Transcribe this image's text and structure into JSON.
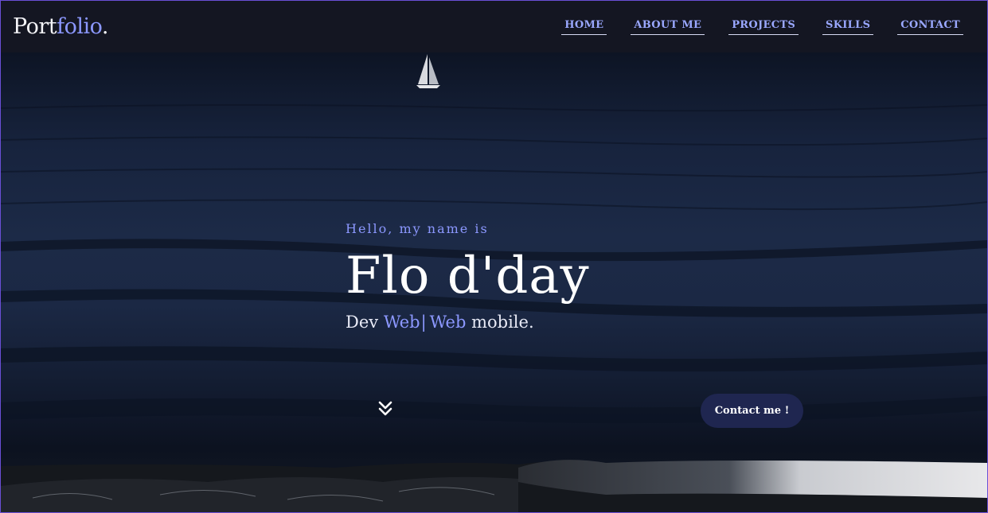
{
  "header": {
    "logo_main": "Port",
    "logo_accent": "folio",
    "logo_dot": ".",
    "nav": [
      {
        "label": "HOME"
      },
      {
        "label": "ABOUT ME"
      },
      {
        "label": "PROJECTS"
      },
      {
        "label": "SKILLS"
      },
      {
        "label": "CONTACT"
      }
    ]
  },
  "hero": {
    "intro": "Hello, my name is",
    "name": "Flo d'day",
    "role_prefix": "Dev",
    "role_word1": "Web",
    "role_separator": "|",
    "role_word2": "Web",
    "role_suffix": "mobile.",
    "scroll_icon": "double-chevron-down-icon",
    "contact_button": "Contact me !"
  },
  "colors": {
    "accent": "#8c98ff",
    "header_bg": "#141622",
    "button_bg": "#1f2650"
  }
}
